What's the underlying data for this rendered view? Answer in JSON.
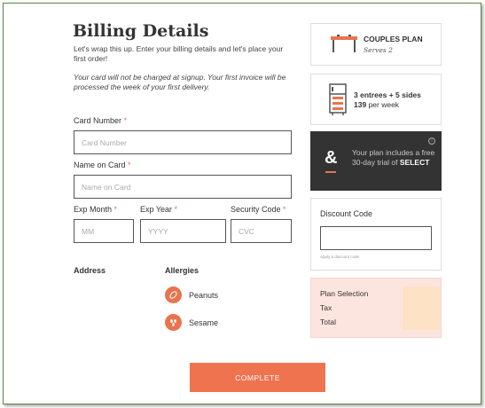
{
  "billing": {
    "title": "Billing Details",
    "intro": "Let's wrap this up. Enter your billing details and let's place your first order!",
    "note": "Your card will not be charged at signup. Your first invoice will be processed the week of your first delivery."
  },
  "fields": {
    "card_number": {
      "label": "Card Number",
      "required": "*",
      "placeholder": "Card Number"
    },
    "name_on_card": {
      "label": "Name on Card",
      "required": "*",
      "placeholder": "Name on Card"
    },
    "exp_month": {
      "label": "Exp Month",
      "required": "*",
      "placeholder": "MM"
    },
    "exp_year": {
      "label": "Exp Year",
      "required": "*",
      "placeholder": "YYYY"
    },
    "security_code": {
      "label": "Security Code",
      "required": "*",
      "placeholder": "CVC"
    }
  },
  "address": {
    "label": "Address"
  },
  "allergies": {
    "label": "Allergies",
    "items": [
      {
        "name": "Peanuts",
        "icon": "peanut-icon"
      },
      {
        "name": "Sesame",
        "icon": "sesame-icon"
      }
    ]
  },
  "complete_button": {
    "label": "COMPLETE"
  },
  "plan": {
    "name": "COUPLES PLAN",
    "serves": "Serves 2",
    "icon": "table-icon"
  },
  "meals": {
    "entrees_sides": "3 entrees + 5 sides",
    "count": "139",
    "per": "per week",
    "icon": "fridge-icon"
  },
  "select_promo": {
    "text": "Your plan includes a free 30-day trial of",
    "highlight": "SELECT",
    "icon": "ampersand-logo",
    "info_icon": "info-icon"
  },
  "discount": {
    "title": "Discount Code",
    "value": "",
    "hint": "Apply a discount code"
  },
  "summary": {
    "lines": [
      "Plan Selection",
      "Tax",
      "Total"
    ]
  },
  "colors": {
    "accent": "#f0734f",
    "dark_card": "#333333",
    "summary_bg": "#fde5df",
    "frame_border": "#5a8a4a"
  }
}
